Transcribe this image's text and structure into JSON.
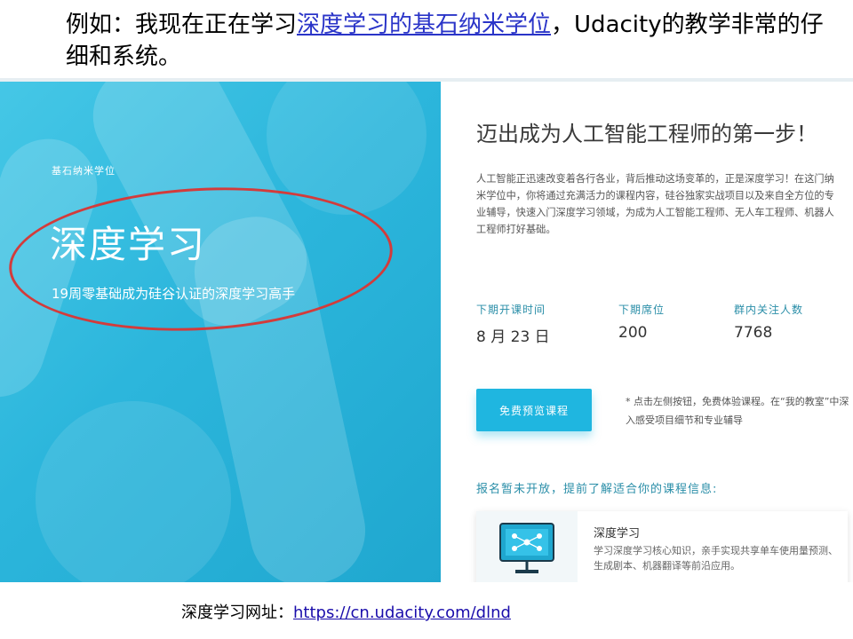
{
  "slide": {
    "title_prefix": "例如：我现在正在学习",
    "title_link": "深度学习的基石纳米学位",
    "title_suffix": "，Udacity的教学非常的仔细和系统。",
    "footer_label": "深度学习网址：",
    "footer_link": "https://cn.udacity.com/dlnd"
  },
  "hero": {
    "subtitle": "基石纳米学位",
    "title": "深度学习",
    "description": "19周零基础成为硅谷认证的深度学习高手"
  },
  "panel": {
    "title": "迈出成为人工智能工程师的第一步！",
    "body": "人工智能正迅速改变着各行各业，背后推动这场变革的，正是深度学习！在这门纳米学位中，你将通过充满活力的课程内容，硅谷独家实战项目以及来自全方位的专业辅导，快速入门深度学习领域，为成为人工智能工程师、无人车工程师、机器人工程师打好基础。",
    "stats": [
      {
        "label": "下期开课时间",
        "value": "8 月 23 日"
      },
      {
        "label": "下期席位",
        "value": "200"
      },
      {
        "label": "群内关注人数",
        "value": "7768"
      }
    ],
    "cta_label": "免费预览课程",
    "note": "* 点击左侧按钮，免费体验课程。在“我的教室”中深入感受项目细节和专业辅导",
    "registration": "报名暂未开放，提前了解适合你的课程信息:",
    "card": {
      "title": "深度学习",
      "description": "学习深度学习核心知识，亲手实现共享单车使用量预测、生成剧本、机器翻译等前沿应用。",
      "icon": "monitor-network-icon"
    }
  },
  "colors": {
    "accent": "#1fb6e0",
    "hero_bg": "#2cb6dc",
    "highlight_oval": "#d33b3b",
    "stat_label": "#2a8ea8"
  }
}
